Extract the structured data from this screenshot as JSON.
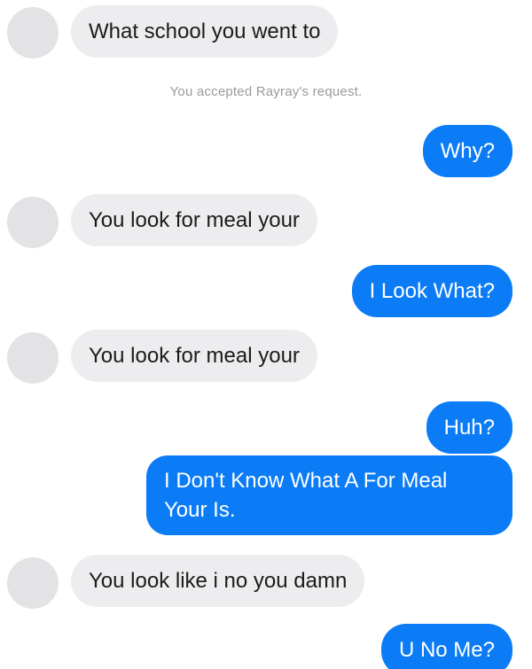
{
  "conversation": {
    "messages": [
      {
        "sender": "other",
        "text": "What school you went to"
      },
      {
        "type": "system",
        "text": "You accepted Rayray's request."
      },
      {
        "sender": "me",
        "text": "Why?"
      },
      {
        "sender": "other",
        "text": "You look for meal your"
      },
      {
        "sender": "me",
        "text": "I Look What?"
      },
      {
        "sender": "other",
        "text": "You look for meal your"
      },
      {
        "sender": "me",
        "text": "Huh?"
      },
      {
        "sender": "me",
        "text": "I Don't Know What A For Meal Your Is."
      },
      {
        "sender": "other",
        "text": "You look like i no you damn"
      },
      {
        "sender": "me",
        "text": "U No Me?"
      }
    ]
  },
  "colors": {
    "outgoing_bubble": "#0b7cf5",
    "incoming_bubble": "#ededf0",
    "avatar": "#e3e3e6",
    "system_text": "#9a9aa0"
  }
}
